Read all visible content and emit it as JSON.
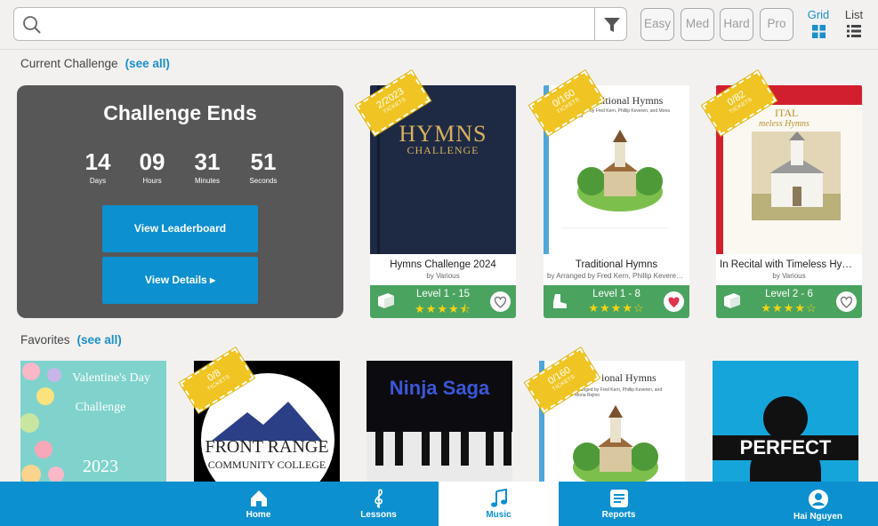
{
  "search": {
    "placeholder": "",
    "value": ""
  },
  "icons": {
    "search": "search-icon",
    "filter": "filter-icon",
    "grid": "grid-icon",
    "list": "list-icon"
  },
  "difficulty": [
    "Easy",
    "Med",
    "Hard",
    "Pro"
  ],
  "view_toggle": {
    "grid": "Grid",
    "list": "List",
    "active": "grid"
  },
  "current_challenge": {
    "label": "Current Challenge",
    "see_all": "(see all)"
  },
  "favorites": {
    "label": "Favorites",
    "see_all": "(see all)"
  },
  "challenge": {
    "title": "Challenge Ends",
    "countdown": [
      {
        "value": "14",
        "unit": "Days"
      },
      {
        "value": "09",
        "unit": "Hours"
      },
      {
        "value": "31",
        "unit": "Minutes"
      },
      {
        "value": "51",
        "unit": "Seconds"
      }
    ],
    "leaderboard_button": "View Leaderboard",
    "details_button": "View Details ▸"
  },
  "challenge_cards": [
    {
      "title": "Hymns Challenge 2024",
      "author": "by Various",
      "level": "Level 1 - 15",
      "rating": "★★★★⯪",
      "ticket_count": "2/2023",
      "ticket_label": "TICKETS",
      "cover_text_1": "HYMNS",
      "cover_text_2": "CHALLENGE",
      "favorite": false,
      "icon": "book-icon"
    },
    {
      "title": "Traditional Hymns",
      "author": "by Arranged by Fred Kern, Phillip Keveren, and Mona Rejino",
      "level": "Level 1 - 8",
      "rating": "★★★★☆",
      "ticket_count": "0/160",
      "ticket_label": "TICKETS",
      "cover_text_1": "ditional Hymns",
      "cover_text_2": "Arranged by Fred Kern, Phillip Keveren, and Mona Rejino",
      "favorite": true,
      "icon": "boot-icon"
    },
    {
      "title": "In Recital with Timeless Hymns",
      "author": "by Various",
      "level": "Level 2 - 6",
      "rating": "★★★★☆",
      "ticket_count": "0/82",
      "ticket_label": "TICKETS",
      "cover_text_1": "ITAL",
      "cover_text_2": "meless Hymns",
      "favorite": false,
      "icon": "book-icon"
    }
  ],
  "favorite_cards": [
    {
      "line1": "Valentine's Day",
      "line2": "Challenge",
      "line3": "2023"
    },
    {
      "line1": "FRONT RANGE",
      "line2": "COMMUNITY COLLEGE",
      "ticket_count": "0/8",
      "ticket_label": "TICKETS"
    },
    {
      "line1": "Ninja Saga"
    },
    {
      "line1": "ional Hymns",
      "line2": "Arranged by Fred Kern, Phillip Keveren, and Mona Rejino",
      "ticket_count": "0/160",
      "ticket_label": "TICKETS"
    },
    {
      "line1": "PERFECT"
    }
  ],
  "nav": [
    {
      "label": "Home",
      "icon": "home-icon"
    },
    {
      "label": "Lessons",
      "icon": "treble-clef-icon"
    },
    {
      "label": "Music",
      "icon": "music-note-icon",
      "active": true
    },
    {
      "label": "Reports",
      "icon": "reports-icon"
    },
    {
      "label": "Hai Nguyen",
      "icon": "profile-icon"
    }
  ],
  "colors": {
    "accent": "#0d90cf",
    "green": "#4ba360",
    "ticket": "#f0c523",
    "panel": "#575757",
    "heart": "#e0344e"
  }
}
